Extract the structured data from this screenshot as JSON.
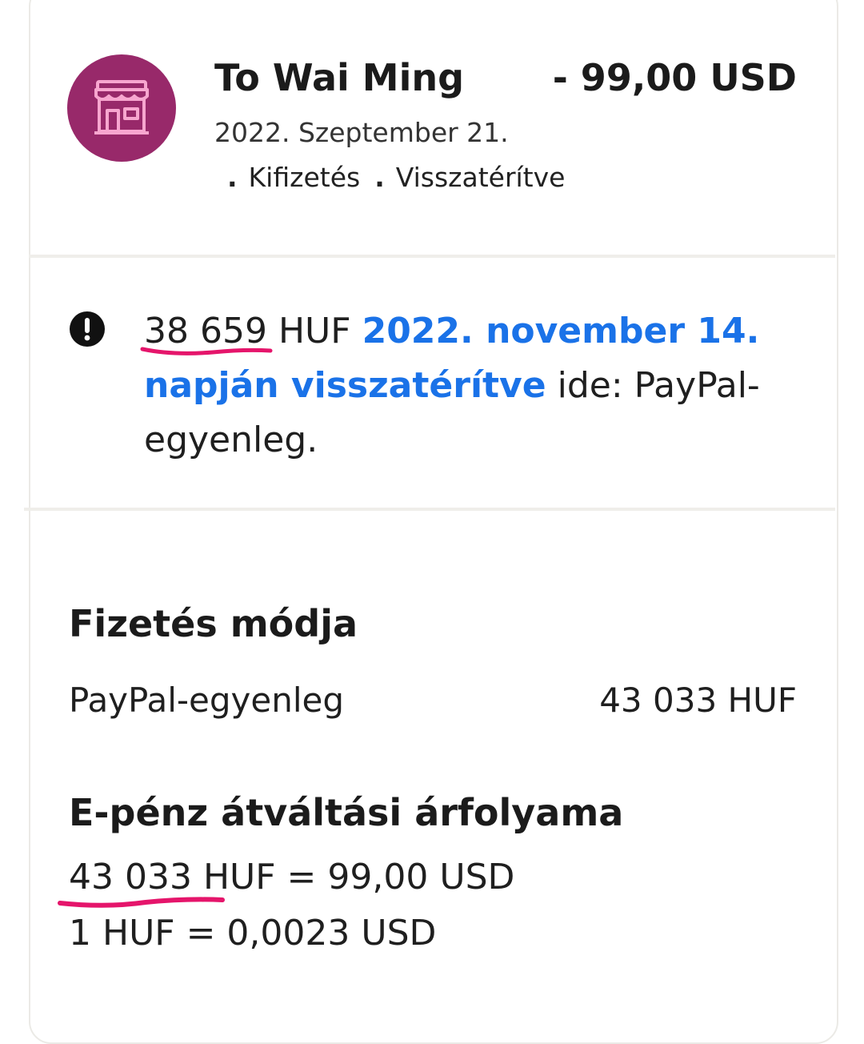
{
  "transaction": {
    "merchant_name": "To Wai Ming",
    "amount": "- 99,00 USD",
    "date": "2022. Szeptember 21.",
    "tags": [
      "Kifizetés",
      "Visszatérítve"
    ],
    "tag_separator": ".",
    "avatar_icon": "store-icon",
    "avatar_color": "#98296a"
  },
  "refund_notice": {
    "icon": "alert-circle-icon",
    "amount_value": "38 659",
    "currency_text": "HUF",
    "link_text": "2022. november 14. napján visszatérítve",
    "trailing_text": "ide: PayPal-egyenleg.",
    "link_color": "#1a72e8"
  },
  "payment_method": {
    "title": "Fizetés módja",
    "source_label": "PayPal-egyenleg",
    "source_amount": "43 033 HUF"
  },
  "exchange_rate": {
    "title": "E-pénz átváltási árfolyama",
    "line1_value": "43 033",
    "line1_rest": "HUF = 99,00 USD",
    "line2": "1 HUF = 0,0023 USD"
  },
  "annotation_color": "#e5156b"
}
